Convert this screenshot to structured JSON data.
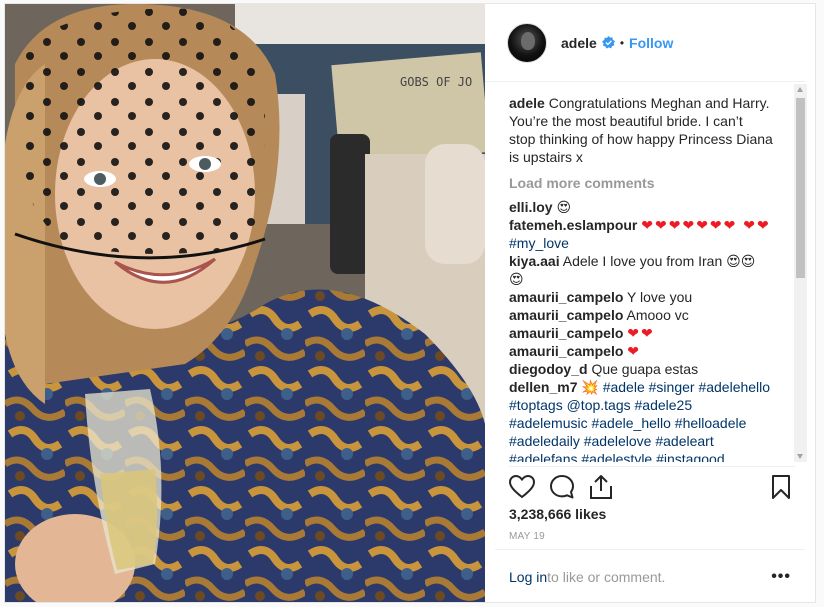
{
  "post": {
    "username": "adele",
    "follow_label": "Follow",
    "dot": "•",
    "caption_user": "adele",
    "caption_text": "Congratulations Meghan and Harry. You’re the most beautiful bride. I can’t stop thinking of how happy Princess Diana is upstairs x",
    "load_more": "Load more comments",
    "likes": "3,238,666 likes",
    "date": "MAY 19",
    "login_link": "Log in",
    "login_rest": " to like or comment.",
    "more_options": "•••",
    "photo_sign_text": "GOBS OF JO"
  },
  "comments": [
    {
      "user": "elli.loy",
      "text": "😍"
    },
    {
      "user": "fatemeh.eslampour",
      "text": "❤❤❤❤❤❤❤ ❤❤",
      "tag": "#my_love"
    },
    {
      "user": "kiya.aai",
      "text": "Adele I love you from Iran 😍😍 😍"
    },
    {
      "user": "amaurii_campelo",
      "text": "Y love you"
    },
    {
      "user": "amaurii_campelo",
      "text": "Amooo vc"
    },
    {
      "user": "amaurii_campelo",
      "text": "❤❤"
    },
    {
      "user": "amaurii_campelo",
      "text": "❤"
    },
    {
      "user": "diegodoy_d",
      "text": "Que guapa estas"
    },
    {
      "user": "dellen_m7",
      "text": "💥",
      "tag": "#adele #singer #adelehello #toptags @top.tags #adele25 #adelemusic #adele_hello #helloadele #adeledaily #adelelove #adeleart #adelefans #adelestyle #instagood #adeleisback #adele #adeleadkins #adelelove #adeleforever"
    }
  ],
  "colors": {
    "accent": "#3897f0",
    "link": "#003569",
    "heart": "#ed1c24",
    "muted": "#999999"
  }
}
